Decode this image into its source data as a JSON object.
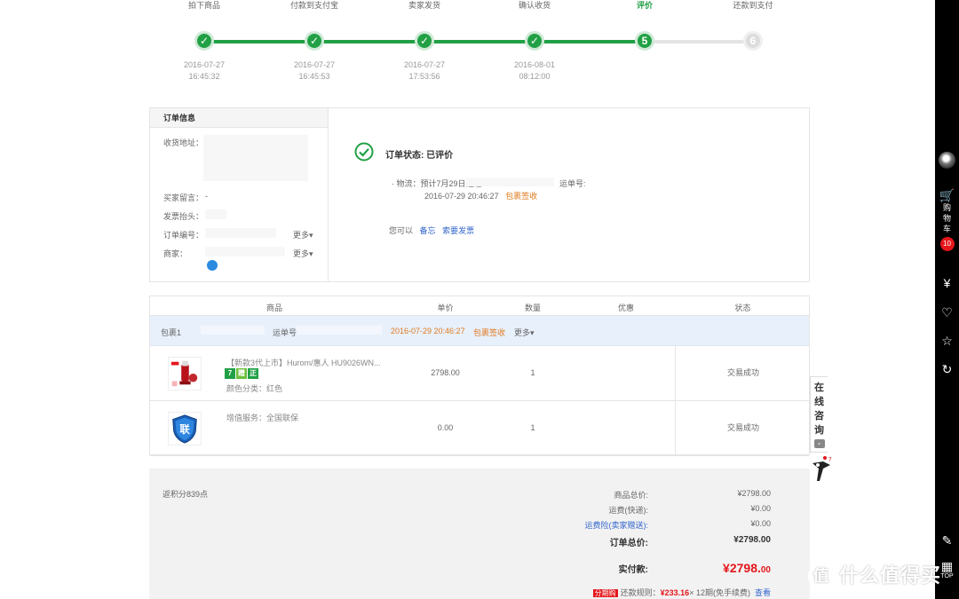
{
  "steps": [
    {
      "label": "拍下商品",
      "num": "✓",
      "date": "2016-07-27",
      "time": "16:45:32",
      "state": "done"
    },
    {
      "label": "付款到支付宝",
      "num": "✓",
      "date": "2016-07-27",
      "time": "16:45:53",
      "state": "done"
    },
    {
      "label": "卖家发货",
      "num": "✓",
      "date": "2016-07-27",
      "time": "17:53:56",
      "state": "done"
    },
    {
      "label": "确认收货",
      "num": "✓",
      "date": "2016-08-01",
      "time": "08:12:00",
      "state": "done"
    },
    {
      "label": "评价",
      "num": "5",
      "date": "",
      "time": "",
      "state": "active"
    },
    {
      "label": "还款到支付",
      "num": "6",
      "date": "",
      "time": "",
      "state": "pending"
    }
  ],
  "order_info": {
    "title": "订单信息",
    "address_label": "收货地址：",
    "message_label": "买家留言：",
    "message_value": "-",
    "invoice_label": "发票抬头：",
    "order_no_label": "订单编号：",
    "seller_label": "商家：",
    "more": "更多▾"
  },
  "status": {
    "text": "订单状态: 已评价",
    "logistics_prefix": "· 物流：",
    "logistics_text": "预计7月29日送达",
    "tracking_label": "运单号:",
    "ship_time": "2016-07-29 20:46:27",
    "package_signed": "包裹签收",
    "you_can": "您可以",
    "action_note": "备忘",
    "action_invoice": "索要发票"
  },
  "table": {
    "headers": [
      "商品",
      "单价",
      "数量",
      "优惠",
      "状态"
    ],
    "package": {
      "label": "包裹1",
      "tracking_label": "运单号",
      "time": "2016-07-29 20:46:27",
      "signed": "包裹签收",
      "more": "更多▾"
    },
    "items": [
      {
        "name": "【新款3代上市】Hurom/惠人 HU9026WN...",
        "tags": [
          "7",
          "赠",
          "正"
        ],
        "spec": "颜色分类：红色",
        "price": "2798.00",
        "qty": "1",
        "status": "交易成功"
      },
      {
        "name": "增值服务：全国联保",
        "tags": [],
        "spec": "",
        "price": "0.00",
        "qty": "1",
        "status": "交易成功"
      }
    ]
  },
  "summary": {
    "points": "返积分839点",
    "rows": [
      {
        "label": "商品总价:",
        "value": "¥2798.00",
        "style": "normal"
      },
      {
        "label": "运费(快递):",
        "value": "¥0.00",
        "style": "normal"
      },
      {
        "label": "运费险(卖家赠送):",
        "value": "¥0.00",
        "style": "link"
      },
      {
        "label": "订单总价:",
        "value": "¥2798.00",
        "style": "bold"
      }
    ],
    "paid_label": "实付款:",
    "paid_main": "¥2798.",
    "paid_cents": "00",
    "installment_badge": "分期购",
    "installment_rule": "还款规则：",
    "installment_amount": "¥233.16",
    "installment_terms": "× 12期(免手续费)",
    "installment_link": "查看"
  },
  "sidebar": {
    "cart_label": "购物车",
    "cart_count": "10",
    "top": "TOP"
  },
  "consult": {
    "text": "在线咨询",
    "chevron": "⌄"
  },
  "watermark": {
    "icon": "值",
    "text": "什么值得买"
  },
  "colors": {
    "accent_green": "#21a045",
    "price_red": "#e4161b",
    "link_blue": "#3366cc",
    "package_bg": "#e8f0fb"
  }
}
